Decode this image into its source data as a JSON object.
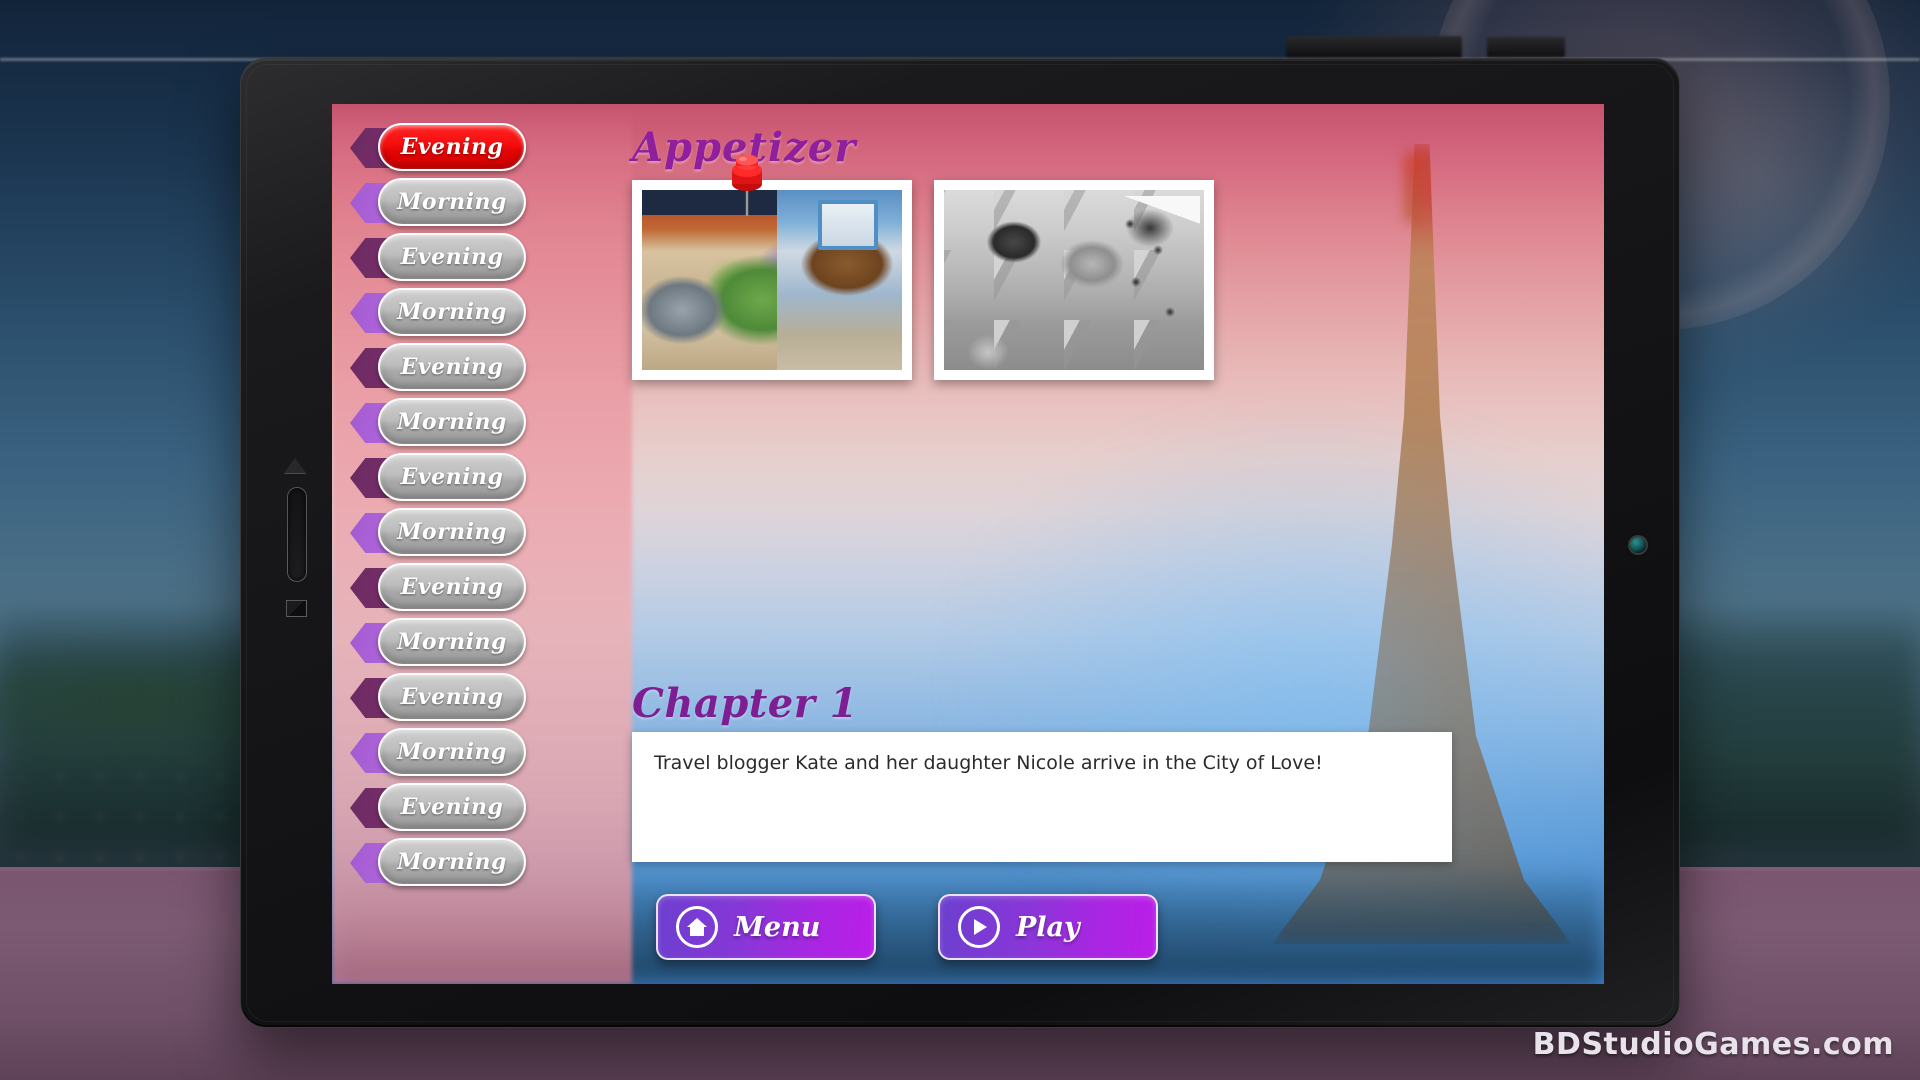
{
  "background": {
    "scene_description": "blurred Paris riverside at dusk with Eiffel Tower",
    "desk_color": "#7a5570"
  },
  "device": {
    "name": "tablet",
    "bezel_color": "#141416",
    "buttons": {
      "volume_up": "volume-up-triangle",
      "volume_slider": "volume-slider",
      "home": "home-square"
    },
    "camera": "front-camera-lens"
  },
  "screen": {
    "section_title": "Appetizer",
    "chapter_title": "Chapter 1",
    "story_text": "Travel blogger Kate and her daughter Nicole arrive in the City of Love!",
    "accent_purple": "#8f1f9c",
    "active_color": "#f50d0d",
    "button_gradient_start": "#6c3fcf",
    "button_gradient_end": "#bb1ee8"
  },
  "level_list": [
    {
      "label": "Evening",
      "time": "evening",
      "state": "active"
    },
    {
      "label": "Morning",
      "time": "morning",
      "state": "normal"
    },
    {
      "label": "Evening",
      "time": "evening",
      "state": "normal"
    },
    {
      "label": "Morning",
      "time": "morning",
      "state": "normal"
    },
    {
      "label": "Evening",
      "time": "evening",
      "state": "normal"
    },
    {
      "label": "Morning",
      "time": "morning",
      "state": "normal"
    },
    {
      "label": "Evening",
      "time": "evening",
      "state": "normal"
    },
    {
      "label": "Morning",
      "time": "morning",
      "state": "normal"
    },
    {
      "label": "Evening",
      "time": "evening",
      "state": "normal"
    },
    {
      "label": "Morning",
      "time": "morning",
      "state": "normal"
    },
    {
      "label": "Evening",
      "time": "evening",
      "state": "normal"
    },
    {
      "label": "Morning",
      "time": "morning",
      "state": "normal"
    },
    {
      "label": "Evening",
      "time": "evening",
      "state": "normal"
    },
    {
      "label": "Morning",
      "time": "morning",
      "state": "normal"
    }
  ],
  "thumbnails": [
    {
      "name": "level-thumb-1",
      "art": "courtyard",
      "state": "unlocked",
      "marker": "red-pushpin"
    },
    {
      "name": "level-thumb-2",
      "art": "food-spread",
      "state": "locked",
      "marker": "none"
    }
  ],
  "actions": [
    {
      "label": "Menu",
      "icon": "home-icon",
      "name": "menu-button"
    },
    {
      "label": "Play",
      "icon": "play-icon",
      "name": "play-button"
    }
  ],
  "watermark": "BDStudioGames.com"
}
